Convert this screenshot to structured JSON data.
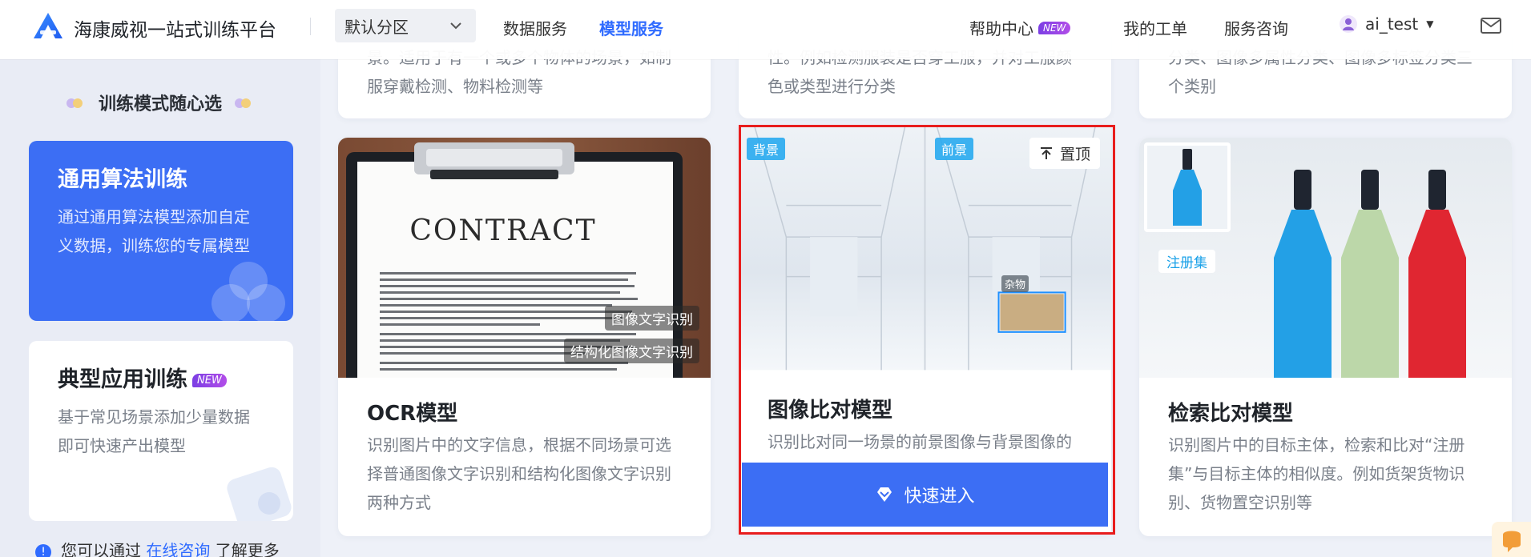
{
  "header": {
    "brand": "海康威视一站式训练平台",
    "zone": "默认分区",
    "nav": [
      "数据服务",
      "模型服务"
    ],
    "help": "帮助中心",
    "new_badge": "NEW",
    "orders": "我的工单",
    "consult": "服务咨询",
    "user": "ai_test"
  },
  "sidebar": {
    "title": "训练模式随心选",
    "cards": [
      {
        "title": "通用算法训练",
        "desc": "通过通用算法模型添加自定义数据，训练您的专属模型"
      },
      {
        "title": "典型应用训练",
        "badge": "NEW",
        "desc": "基于常见场景添加少量数据即可快速产出模型"
      }
    ],
    "consult_prefix": "您可以通过",
    "consult_link": "在线咨询",
    "consult_suffix": "了解更多"
  },
  "top_cards": [
    {
      "desc": "景。适用于有一个或多个物体的场景，如制服穿戴检测、物料检测等"
    },
    {
      "desc": "性。例如检测服装是否穿工服，并对工服颜色或类型进行分类"
    },
    {
      "desc": "分类、图像多属性分类、图像多标签分类三个类别"
    }
  ],
  "cards": [
    {
      "name": "OCR模型",
      "desc": "识别图片中的文字信息，根据不同场景可选择普通图像文字识别和结构化图像文字识别两种方式",
      "tags": [
        "图像文字识别",
        "结构化图像文字识别"
      ],
      "contract": "CONTRACT"
    },
    {
      "name": "图像比对模型",
      "desc": "识别比对同一场景的前景图像与背景图像的差异，例如通道杂物检测、违规摆放检测等",
      "tags": [
        "背景",
        "前景",
        "杂物"
      ],
      "pin": "置顶",
      "button": "快速进入"
    },
    {
      "name": "检索比对模型",
      "desc": "识别图片中的目标主体，检索和比对“注册集”与目标主体的相似度。例如货架货物识别、货物置空识别等",
      "reg": "注册集"
    }
  ]
}
